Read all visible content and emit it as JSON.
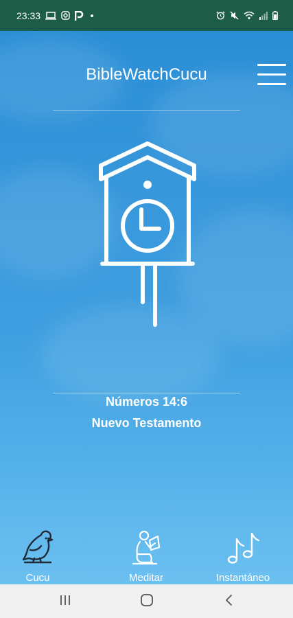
{
  "status_bar": {
    "time": "23:33",
    "left_icons": [
      "laptop-icon",
      "instagram-icon",
      "parking-app-icon",
      "notification-dot-icon"
    ],
    "right_icons": [
      "alarm-icon",
      "mute-icon",
      "wifi-icon",
      "signal-icon",
      "battery-icon"
    ]
  },
  "header": {
    "title": "BibleWatchCucu",
    "menu_icon": "hamburger-menu-icon"
  },
  "illustration": {
    "icon": "cuckoo-clock-icon"
  },
  "verse": {
    "reference": "Números  14:6",
    "testament": "Nuevo Testamento"
  },
  "bottom_nav": {
    "items": [
      {
        "label": "Cucu",
        "icon": "bird-icon"
      },
      {
        "label": "Meditar",
        "icon": "person-praying-icon"
      },
      {
        "label": "Instantáneo",
        "icon": "music-notes-icon"
      }
    ]
  },
  "system_nav": {
    "buttons": [
      "recent-apps-icon",
      "home-icon",
      "back-icon"
    ]
  },
  "colors": {
    "status_bar": "#1d5d48",
    "sky_top": "#2a8ed6",
    "sky_bottom": "#6cc0f0",
    "foreground": "#ffffff",
    "system_nav": "#f1f1f1"
  }
}
